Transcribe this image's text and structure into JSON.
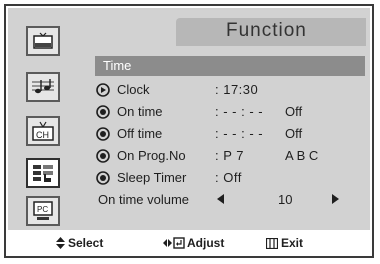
{
  "title": "Function",
  "section": "Time",
  "sidebar": {
    "items": [
      {
        "name": "picture-icon"
      },
      {
        "name": "sound-icon"
      },
      {
        "name": "channel-icon",
        "label": "CH"
      },
      {
        "name": "function-icon"
      },
      {
        "name": "pc-icon",
        "label": "PC"
      }
    ]
  },
  "rows": [
    {
      "label": "Clock",
      "value": ": 17:30",
      "extra": "",
      "bullet": "play"
    },
    {
      "label": "On time",
      "value": ": - - : - -",
      "extra": "Off",
      "bullet": "dot"
    },
    {
      "label": "Off time",
      "value": ": - - : - -",
      "extra": "Off",
      "bullet": "dot"
    },
    {
      "label": "On Prog.No",
      "value": ": P  7",
      "extra": "A B C",
      "bullet": "dot"
    },
    {
      "label": "Sleep Timer",
      "value": ": Off",
      "extra": "",
      "bullet": "dot"
    }
  ],
  "volume": {
    "label": "On time volume",
    "value": "10"
  },
  "footer": {
    "select": "Select",
    "adjust": "Adjust",
    "exit": "Exit"
  }
}
